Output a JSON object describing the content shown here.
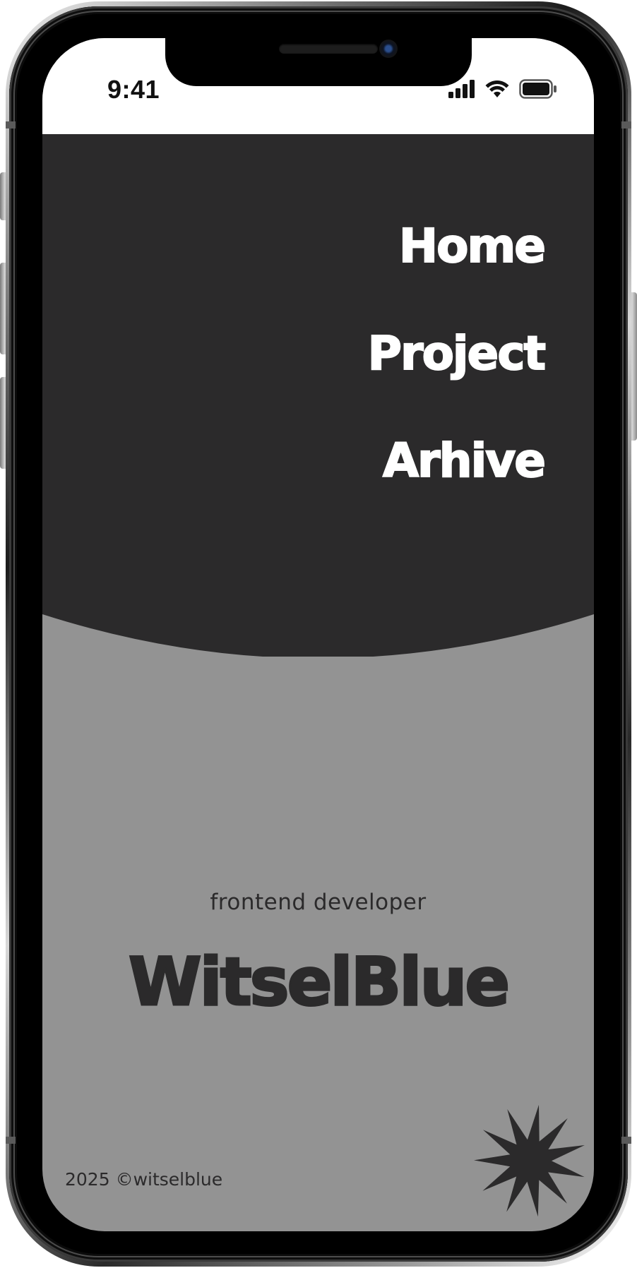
{
  "status_bar": {
    "time": "9:41",
    "icons": [
      "cellular-signal-icon",
      "wifi-icon",
      "battery-icon"
    ]
  },
  "nav": {
    "items": [
      {
        "label": "Home"
      },
      {
        "label": "Project"
      },
      {
        "label": "Arhive"
      }
    ]
  },
  "hero": {
    "subtitle": "frontend developer",
    "brand": "WitselBlue"
  },
  "footer": {
    "copyright": "2025 ©witselblue",
    "decoration_icon": "starburst-icon"
  },
  "colors": {
    "menu_background": "#2b2a2b",
    "page_background": "#939393",
    "nav_text": "#ffffff",
    "content_text": "#2b2a2b",
    "status_bar_background": "#ffffff"
  }
}
